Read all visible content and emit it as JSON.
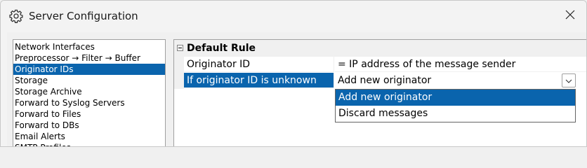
{
  "window": {
    "title": "Server Configuration",
    "title_icon": "gear-icon",
    "close_icon": "close-icon"
  },
  "nav": {
    "items": [
      {
        "label": "Network Interfaces",
        "selected": false
      },
      {
        "label": "Preprocessor → Filter → Buffer",
        "selected": false
      },
      {
        "label": "Originator IDs",
        "selected": true
      },
      {
        "label": "Storage",
        "selected": false
      },
      {
        "label": "Storage Archive",
        "selected": false
      },
      {
        "label": "Forward to Syslog Servers",
        "selected": false
      },
      {
        "label": "Forward to Files",
        "selected": false
      },
      {
        "label": "Forward to DBs",
        "selected": false
      },
      {
        "label": "Email Alerts",
        "selected": false
      },
      {
        "label": "SMTP Profiles",
        "selected": false
      }
    ]
  },
  "grid": {
    "group_title": "Default Rule",
    "rows": [
      {
        "name": "Originator ID",
        "value": "= IP address of the message sender"
      },
      {
        "name": "If originator ID is unknown",
        "value": "Add new originator"
      }
    ],
    "dropdown": {
      "options": [
        "Add new originator",
        "Discard messages"
      ],
      "highlighted_index": 0
    }
  },
  "colors": {
    "selection": "#0a64ad",
    "window_bg": "#f3f3f3"
  }
}
